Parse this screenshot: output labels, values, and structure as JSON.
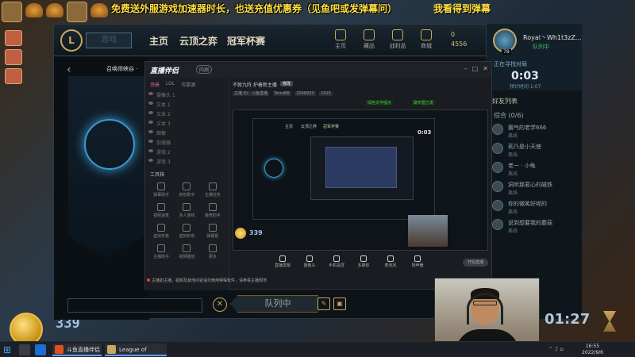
{
  "overlay": {
    "marquee": "免费送外服游戏加速器时长，也送充值优惠券（见鱼吧或发弹幕问）",
    "marquee2": "我看得到弹幕",
    "coin_count": "339",
    "queue_timer": "01:27"
  },
  "client": {
    "logo": "L",
    "play_button": "游戏",
    "nav": [
      "主页",
      "云顶之弈",
      "冠军杯赛"
    ],
    "top_icons": [
      {
        "label": "主页",
        "icon": "home-icon"
      },
      {
        "label": "藏品",
        "icon": "collection-icon"
      },
      {
        "label": "战利品",
        "icon": "loot-icon"
      },
      {
        "label": "商城",
        "icon": "store-icon"
      }
    ],
    "rp": "0",
    "be": "4556",
    "level": "78",
    "map_title": "召唤师峡谷 ·",
    "queue_button": "队列中",
    "cancel_glyph": "✕"
  },
  "friends": {
    "username": "Royal丶Wh1t3zZ...",
    "status": "队列中",
    "timer_label": "正在寻找对局",
    "timer": "0:03",
    "timer_sub": "预计时间 1:07",
    "title": "好友列表",
    "group": "综合 (0/6)",
    "list": [
      {
        "name": "霸气的老学666",
        "status": "离线"
      },
      {
        "name": "莉乃是小天使",
        "status": "离线"
      },
      {
        "name": "老一 · 小龟",
        "status": "离线"
      },
      {
        "name": "洞听那君心的磁铁",
        "status": "离线"
      },
      {
        "name": "你的微笑好呢的",
        "status": "离线"
      },
      {
        "name": "说到想要我的蘑菇",
        "status": "离线"
      }
    ]
  },
  "stream": {
    "logo": "直播伴侣",
    "badge": "内测",
    "tabs": [
      "场景",
      "LOL",
      "可靠源"
    ],
    "scenes": [
      "摄像头 1",
      "文本 1",
      "文本 2",
      "文本 3",
      "图像",
      "加速器",
      "游戏 2",
      "游戏 3"
    ],
    "tools_title": "工具箱",
    "tools": [
      "弹幕助手",
      "房管助手",
      "主播任务",
      "视频连麦",
      "多人连线",
      "装修助手",
      "虚拟形象",
      "虚拟形象",
      "弹幕姬",
      "主播助手",
      "视频播放",
      "更多"
    ],
    "room_title": "不就九阵 护着新主播",
    "room_tag": "修改",
    "meta": [
      "主播 ID：斗鱼直播",
      "TerraBB",
      "2048933",
      "1915"
    ],
    "green1": "绿色文字提示",
    "green2": "聊天框已发",
    "controls": [
      "直播屏幕",
      "摄像头",
      "手机投屏",
      "多媒体",
      "麦克风",
      "扬声器"
    ],
    "start_button": "开始直播",
    "notice": "主播如主播，视频及其他内容请勿使用特殊软件，请参看主播规范"
  },
  "taskbar": {
    "apps": [
      "斗鱼直播伴侣",
      "League of Legends"
    ],
    "time": "16:55",
    "date": "2022/9/6"
  }
}
